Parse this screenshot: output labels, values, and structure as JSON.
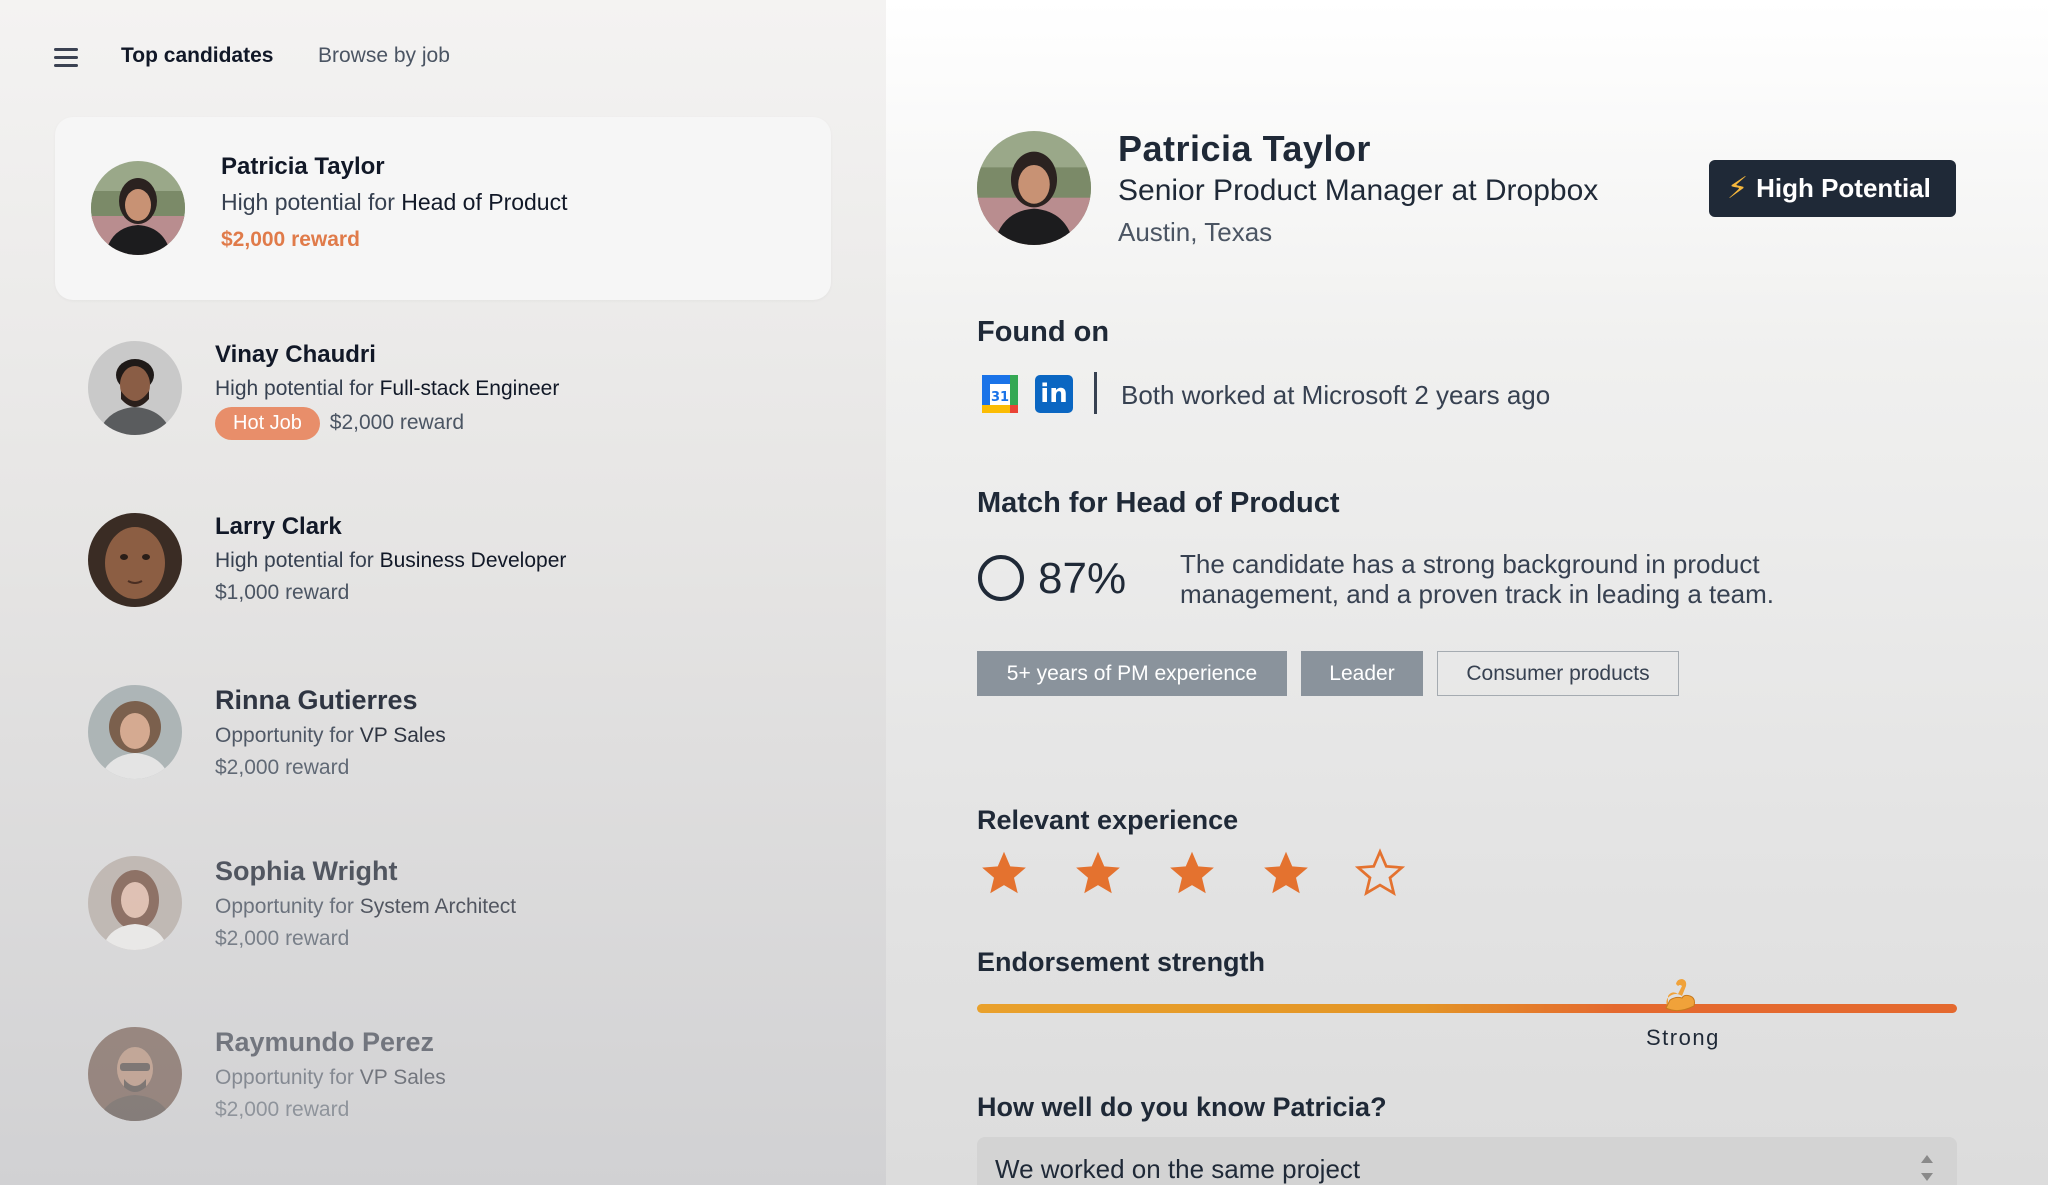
{
  "nav": {
    "tabs": [
      {
        "label": "Top candidates"
      },
      {
        "label": "Browse by job"
      }
    ]
  },
  "candidates": [
    {
      "name": "Patricia Taylor",
      "prefix": "High potential for",
      "role": "Head of Product",
      "reward": "$2,000 reward",
      "selected": true
    },
    {
      "name": "Vinay Chaudri",
      "prefix": "High potential for",
      "role": "Full-stack Engineer",
      "badge": "Hot Job",
      "reward": "$2,000 reward"
    },
    {
      "name": "Larry Clark",
      "prefix": "High potential for",
      "role": "Business Developer",
      "reward": "$1,000 reward"
    },
    {
      "name": "Rinna Gutierres",
      "prefix": "Opportunity for",
      "role": "VP Sales",
      "reward": "$2,000 reward"
    },
    {
      "name": "Sophia Wright",
      "prefix": "Opportunity for",
      "role": "System Architect",
      "reward": "$2,000 reward"
    },
    {
      "name": "Raymundo Perez",
      "prefix": "Opportunity for",
      "role": "VP Sales",
      "reward": "$2,000 reward"
    }
  ],
  "profile": {
    "name": "Patricia Taylor",
    "title": "Senior Product Manager at Dropbox",
    "location": "Austin, Texas",
    "badge": "High Potential",
    "found_on": {
      "heading": "Found on",
      "calendar_day": "31",
      "linkedin_label": "in",
      "text": "Both worked at Microsoft 2 years ago"
    },
    "match": {
      "heading": "Match for Head of Product",
      "percent_label": "87%",
      "percent_value": 0.87,
      "description": "The candidate has a strong background in product management, and a proven track in leading a team.",
      "tags": [
        "5+ years of PM experience",
        "Leader",
        "Consumer products"
      ]
    },
    "relevant_experience": {
      "heading": "Relevant experience",
      "rating": 4,
      "max": 5
    },
    "endorsement": {
      "heading": "Endorsement strength",
      "level_label": "Strong",
      "level_value": 0.72
    },
    "know": {
      "heading": "How well do you know Patricia?",
      "selected": "We worked on the same project"
    }
  },
  "colors": {
    "accent_orange": "#e07b4a",
    "star_orange": "#e4722f",
    "badge_dark": "#1f2937",
    "linkedin_blue": "#0a66c2"
  }
}
